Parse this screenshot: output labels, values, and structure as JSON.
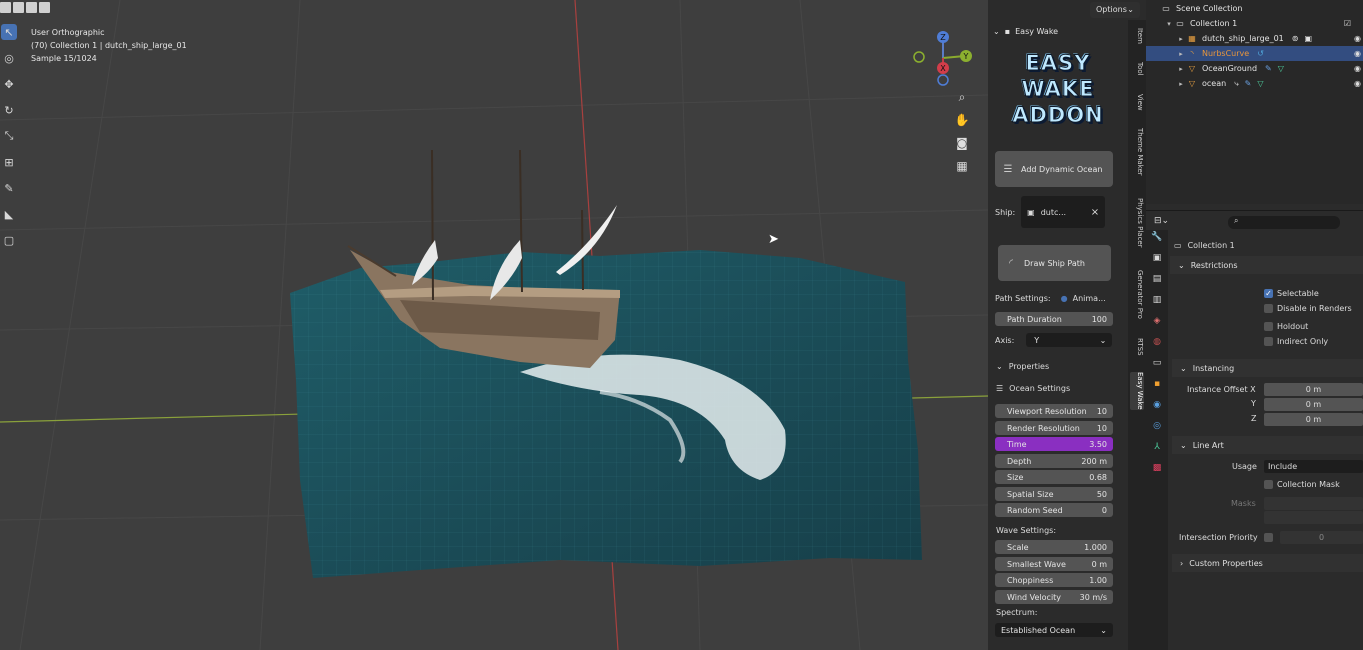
{
  "viewport": {
    "view_name": "User Orthographic",
    "collection_info": "(70) Collection 1 | dutch_ship_large_01",
    "sample": "Sample 15/1024",
    "options_label": "Options",
    "gizmo": {
      "z": "Z",
      "y": "Y",
      "x": "X"
    }
  },
  "npanel": {
    "header": "Easy Wake",
    "logo": [
      "EASY",
      "WAKE",
      "ADDON"
    ],
    "add_ocean_label": "Add Dynamic Ocean",
    "ship_label": "Ship:",
    "ship_value": "dutc...",
    "draw_path_label": "Draw Ship Path",
    "path_settings_label": "Path Settings:",
    "path_settings_value": "Anima...",
    "path_duration_label": "Path Duration",
    "path_duration_value": "100",
    "axis_label": "Axis:",
    "axis_value": "Y",
    "properties_label": "Properties",
    "ocean_settings_label": "Ocean Settings",
    "ocean_fields": [
      {
        "label": "Viewport Resolution",
        "value": "10"
      },
      {
        "label": "Render Resolution",
        "value": "10"
      },
      {
        "label": "Time",
        "value": "3.50"
      },
      {
        "label": "Depth",
        "value": "200 m"
      },
      {
        "label": "Size",
        "value": "0.68"
      },
      {
        "label": "Spatial Size",
        "value": "50"
      },
      {
        "label": "Random Seed",
        "value": "0"
      }
    ],
    "wave_settings_label": "Wave Settings:",
    "wave_fields": [
      {
        "label": "Scale",
        "value": "1.000"
      },
      {
        "label": "Smallest Wave",
        "value": "0 m"
      },
      {
        "label": "Choppiness",
        "value": "1.00"
      },
      {
        "label": "Wind Velocity",
        "value": "30 m/s"
      }
    ],
    "spectrum_label": "Spectrum:",
    "spectrum_value": "Established Ocean",
    "tabs": [
      "Item",
      "Tool",
      "View",
      "Theme Maker",
      "Physics Placer",
      "Generator Pro",
      "RTSS",
      "Easy Wake"
    ]
  },
  "outliner": {
    "scene_collection": "Scene Collection",
    "collection": "Collection 1",
    "items": [
      {
        "name": "dutch_ship_large_01",
        "selected": false
      },
      {
        "name": "NurbsCurve",
        "selected": true
      },
      {
        "name": "OceanGround",
        "selected": false
      },
      {
        "name": "ocean",
        "selected": false
      }
    ]
  },
  "properties": {
    "search_placeholder": "",
    "title": "Collection 1",
    "restrictions_label": "Restrictions",
    "checkboxes": [
      {
        "label": "Selectable",
        "checked": true
      },
      {
        "label": "Disable in Renders",
        "checked": false
      },
      {
        "label": "Holdout",
        "checked": false
      },
      {
        "label": "Indirect Only",
        "checked": false
      }
    ],
    "instancing_label": "Instancing",
    "instance_offset_label": "Instance Offset X",
    "offset_y_label": "Y",
    "offset_z_label": "Z",
    "offset_x": "0 m",
    "offset_y": "0 m",
    "offset_z": "0 m",
    "line_art_label": "Line Art",
    "usage_label": "Usage",
    "usage_value": "Include",
    "collection_mask_label": "Collection Mask",
    "masks_label": "Masks",
    "intersection_label": "Intersection Priority",
    "intersection_value": "0",
    "custom_props_label": "Custom Properties"
  },
  "colors": {
    "accent": "#4772b3",
    "highlight": "#8a2fc1",
    "selected_row": "#334d80",
    "ocean": "#1f5a66"
  }
}
